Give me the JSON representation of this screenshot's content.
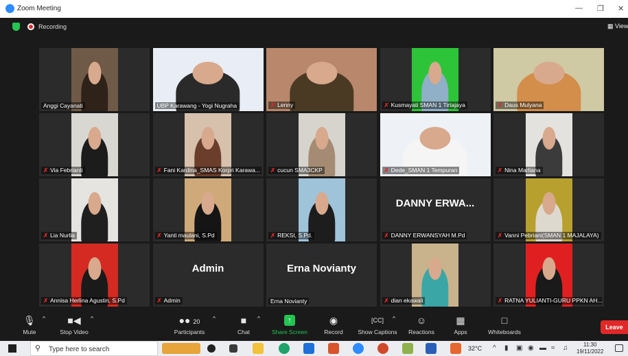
{
  "window": {
    "title": "Zoom Meeting",
    "minimize": "—",
    "restore": "❐",
    "close": "✕"
  },
  "topbar": {
    "recording_label": "Recording",
    "view_label": "View"
  },
  "tiles": [
    {
      "name": "Anggi Cayanati",
      "muted": false,
      "bg": "#6f5a48",
      "person": "#2f2219"
    },
    {
      "name": "UBP Karawang - Yogi Nugraha",
      "muted": false,
      "bg": "#e9eef6",
      "person": "#2a2a2a"
    },
    {
      "name": "Lenny",
      "muted": true,
      "bg": "#b9876b",
      "person": "#4a3a24"
    },
    {
      "name": "Kusmayati SMAN 1 Tirtajaya",
      "muted": true,
      "bg": "#2ec43a",
      "person": "#8fb0c6"
    },
    {
      "name": "Daus Mulyana",
      "muted": true,
      "bg": "#cfc9a4",
      "person": "#d28e4a"
    },
    {
      "name": "Via Febrianti",
      "muted": true,
      "bg": "#d9d7d2",
      "person": "#1c1c1c"
    },
    {
      "name": "Fani Kardina_SMAS Korpri Karawa...",
      "muted": true,
      "bg": "#d7c1ad",
      "person": "#6b3e2c"
    },
    {
      "name": "cucun SMA3CKP",
      "muted": true,
      "bg": "#d6d4cd",
      "person": "#a58b73"
    },
    {
      "name": "Dede_SMAN 1 Tempuran",
      "muted": true,
      "bg": "#eef1f6",
      "person": "#f5f5f5"
    },
    {
      "name": "Nina Marliana",
      "muted": true,
      "bg": "#e4e2de",
      "person": "#3b3b3b"
    },
    {
      "name": "Lia Nurlia",
      "muted": true,
      "bg": "#e6e4e0",
      "person": "#1f1f1f"
    },
    {
      "name": "Yanti maulani, S.Pd",
      "muted": true,
      "bg": "#cfa97a",
      "person": "#151515"
    },
    {
      "name": "REKSI, S.Pd.",
      "muted": true,
      "bg": "#9fc3d9",
      "person": "#1d1d1d"
    },
    {
      "name": "DANNY ERWANSYAH M.Pd",
      "muted": true,
      "display_name": "DANNY  ERWA..."
    },
    {
      "name": "Vanni Pebriani(SMAN 1 MAJALAYA)",
      "muted": true,
      "bg": "#b8a02f",
      "person": "#ded9cf"
    },
    {
      "name": "Annisa Herlina Agustin, S.Pd",
      "muted": true,
      "bg": "#d42a22",
      "person": "#1a1a1a"
    },
    {
      "name": "Admin",
      "muted": true,
      "display_name": "Admin"
    },
    {
      "name": "Erna Novianty",
      "muted": false,
      "display_name": "Erna Novianty"
    },
    {
      "name": "dian ekawali",
      "muted": true,
      "bg": "#c9b38d",
      "person": "#3aa6a6"
    },
    {
      "name": "RATNA YULIANTI-GURU PPKN AH...",
      "muted": true,
      "bg": "#e02020",
      "person": "#1a1a1a"
    }
  ],
  "toolbar": {
    "mute": "Mute",
    "stop_video": "Stop Video",
    "participants": "Participants",
    "participants_count": "20",
    "chat": "Chat",
    "share_screen": "Share Screen",
    "record": "Record",
    "show_captions": "Show Captions",
    "reactions": "Reactions",
    "apps": "Apps",
    "whiteboards": "Whiteboards",
    "leave": "Leave"
  },
  "taskbar": {
    "search_placeholder": "Type here to search",
    "temperature": "32°C",
    "time": "11:30",
    "date": "19/11/2022"
  },
  "colors": {
    "accent_green": "#23c552",
    "leave_red": "#e02828",
    "active_speaker": "#c9e25c"
  }
}
